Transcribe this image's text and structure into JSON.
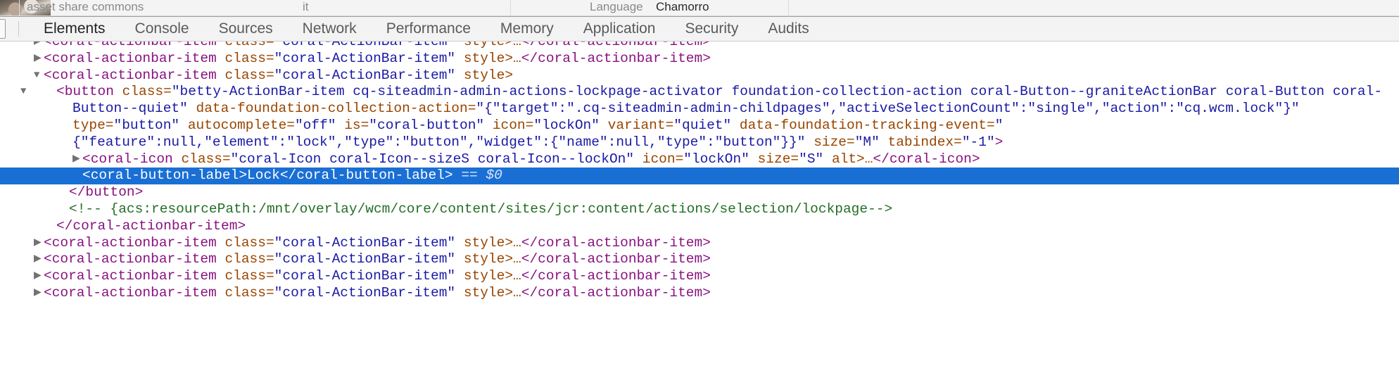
{
  "page_strip": {
    "asset_share_label": "asset share commons",
    "thumbnail_alt": "thumbnail-image",
    "it_label": "it",
    "language_label": "Language",
    "language_value": "Chamorro"
  },
  "devtools": {
    "dock_icon": "dock-panel-icon",
    "tabs": [
      {
        "label": "Elements",
        "selected": true
      },
      {
        "label": "Console",
        "selected": false
      },
      {
        "label": "Sources",
        "selected": false
      },
      {
        "label": "Network",
        "selected": false
      },
      {
        "label": "Performance",
        "selected": false
      },
      {
        "label": "Memory",
        "selected": false
      },
      {
        "label": "Application",
        "selected": false
      },
      {
        "label": "Security",
        "selected": false
      },
      {
        "label": "Audits",
        "selected": false
      }
    ],
    "selected_tab": "Elements",
    "colors": {
      "tag": "#881280",
      "attribute": "#994500",
      "value": "#1a1aa6",
      "comment": "#236e25",
      "selection": "#1a6fd4",
      "toolbar_bg": "#f3f3f3"
    }
  },
  "dom_tree": {
    "lines": {
      "l1": {
        "tag_open": "<coral-actionbar-item",
        "attr": "class=",
        "value": "\"coral-ActionBar-item\"",
        "attr2": "style>",
        "ellipsis": "…",
        "tag_close": "</coral-actionbar-item>"
      },
      "l2": {
        "tag_open": "<coral-actionbar-item",
        "attr": "class=",
        "value": "\"coral-ActionBar-item\"",
        "attr2": "style>",
        "ellipsis": "…",
        "tag_close": "</coral-actionbar-item>"
      },
      "l3": {
        "tag_open": "<coral-actionbar-item",
        "attr": "class=",
        "value": "\"coral-ActionBar-item\"",
        "attr2": "style>"
      },
      "button": {
        "tag_open": "<button",
        "class_attr": "class=",
        "class_value": "\"betty-ActionBar-item cq-siteadmin-admin-actions-lockpage-activator foundation-collection-action coral-Button--graniteActionBar coral-Button coral-Button--quiet\"",
        "fca_attr": "data-foundation-collection-action=",
        "fca_value": "\"{\"target\":\".cq-siteadmin-admin-childpages\",\"activeSelectionCount\":\"single\",\"action\":\"cq.wcm.lock\"}\"",
        "type_attr": "type=",
        "type_value": "\"button\"",
        "autocomplete_attr": "autocomplete=",
        "autocomplete_value": "\"off\"",
        "is_attr": "is=",
        "is_value": "\"coral-button\"",
        "icon_attr": "icon=",
        "icon_value": "\"lockOn\"",
        "variant_attr": "variant=",
        "variant_value": "\"quiet\"",
        "tracking_attr": "data-foundation-tracking-event=",
        "tracking_value": "\"{\"feature\":null,\"element\":\"lock\",\"type\":\"button\",\"widget\":{\"name\":null,\"type\":\"button\"}}\"",
        "size_attr": "size=",
        "size_value": "\"M\"",
        "tabindex_attr": "tabindex=",
        "tabindex_value": "\"-1\"",
        "close_bracket": ">"
      },
      "coral_icon": {
        "tag_open": "<coral-icon",
        "class_attr": "class=",
        "class_value": "\"coral-Icon coral-Icon--sizeS coral-Icon--lockOn\"",
        "icon_attr": "icon=",
        "icon_value": "\"lockOn\"",
        "size_attr": "size=",
        "size_value": "\"S\"",
        "alt_attr": "alt>",
        "ellipsis": "…",
        "tag_close": "</coral-icon>"
      },
      "button_label": {
        "tag_open": "<coral-button-label>",
        "text": "Lock",
        "tag_close": "</coral-button-label>",
        "selected_marker": "== $0",
        "selected": true
      },
      "button_end": {
        "tag_close": "</button>"
      },
      "comment": {
        "text": "<!-- {acs:resourcePath:/mnt/overlay/wcm/core/content/sites/jcr:content/actions/selection/lockpage-->"
      },
      "item_end": {
        "tag_close": "</coral-actionbar-item>"
      },
      "l_tail1": {
        "tag_open": "<coral-actionbar-item",
        "attr": "class=",
        "value": "\"coral-ActionBar-item\"",
        "attr2": "style>",
        "ellipsis": "…",
        "tag_close": "</coral-actionbar-item>"
      },
      "l_tail2": {
        "tag_open": "<coral-actionbar-item",
        "attr": "class=",
        "value": "\"coral-ActionBar-item\"",
        "attr2": "style>",
        "ellipsis": "…",
        "tag_close": "</coral-actionbar-item>"
      },
      "l_tail3": {
        "tag_open": "<coral-actionbar-item",
        "attr": "class=",
        "value": "\"coral-ActionBar-item\"",
        "attr2": "style>",
        "ellipsis": "…",
        "tag_close": "</coral-actionbar-item>"
      },
      "l_tail4": {
        "tag_open": "<coral-actionbar-item",
        "attr": "class=",
        "value": "\"coral-ActionBar-item\"",
        "attr2": "style>",
        "ellipsis": "…",
        "tag_close": "</coral-actionbar-item>"
      }
    }
  }
}
